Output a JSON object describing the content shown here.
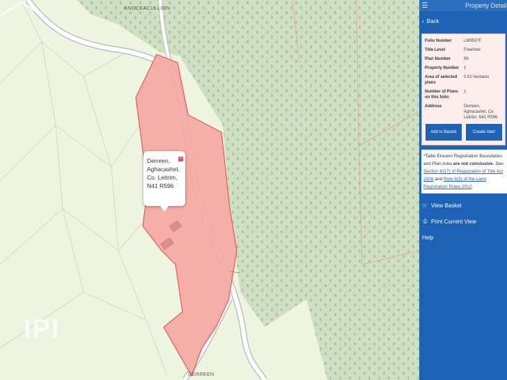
{
  "map": {
    "road_labels": [
      "KNOCKACULLION",
      "DERREEN"
    ],
    "popup": {
      "text": "Derreen,\nAghacashel,\nCo. Leitrim,\nN41 R596",
      "close_icon": "x-icon"
    },
    "watermark": "IPI",
    "colors": {
      "forest": "#cfe0c2",
      "field": "#eef4df",
      "parcel": "#f5a6a2",
      "parcel_border": "#e05a55",
      "road": "#ffffff"
    }
  },
  "panel": {
    "title": "Property Details",
    "back_label": "Back",
    "details": [
      {
        "label": "Folio Number",
        "value": "LM9537F"
      },
      {
        "label": "Title Level",
        "value": "Freehold"
      },
      {
        "label": "Plan Number",
        "value": "99"
      },
      {
        "label": "Property Number",
        "value": "1"
      },
      {
        "label": "Area of selected plans",
        "value": "0.91 hectares"
      },
      {
        "label": "Number of Plans on this folio:",
        "value": "1"
      },
      {
        "label": "Address",
        "value": "Derreen, Aghacashel, Co. Leitrim, N41 R596"
      }
    ],
    "add_button": "Add to Basket",
    "alert_button": "Create Alert",
    "note": {
      "prefix": "*Tailte Éireann Registration Boundaries and Plan Area ",
      "bold": "are not conclusive",
      "mid1": ". See ",
      "link1": "Section 62(7) of Registration of Title Act 2006",
      "mid2": " and ",
      "link2": "Rule 8(3) of the Land Registration Rules 2012",
      "suffix": "."
    },
    "menu": [
      {
        "label": "View Basket",
        "icon": "cart-icon"
      },
      {
        "label": "Print Current View",
        "icon": "print-icon"
      },
      {
        "label": "Help",
        "icon": ""
      }
    ],
    "accent": "#1d62b5"
  }
}
